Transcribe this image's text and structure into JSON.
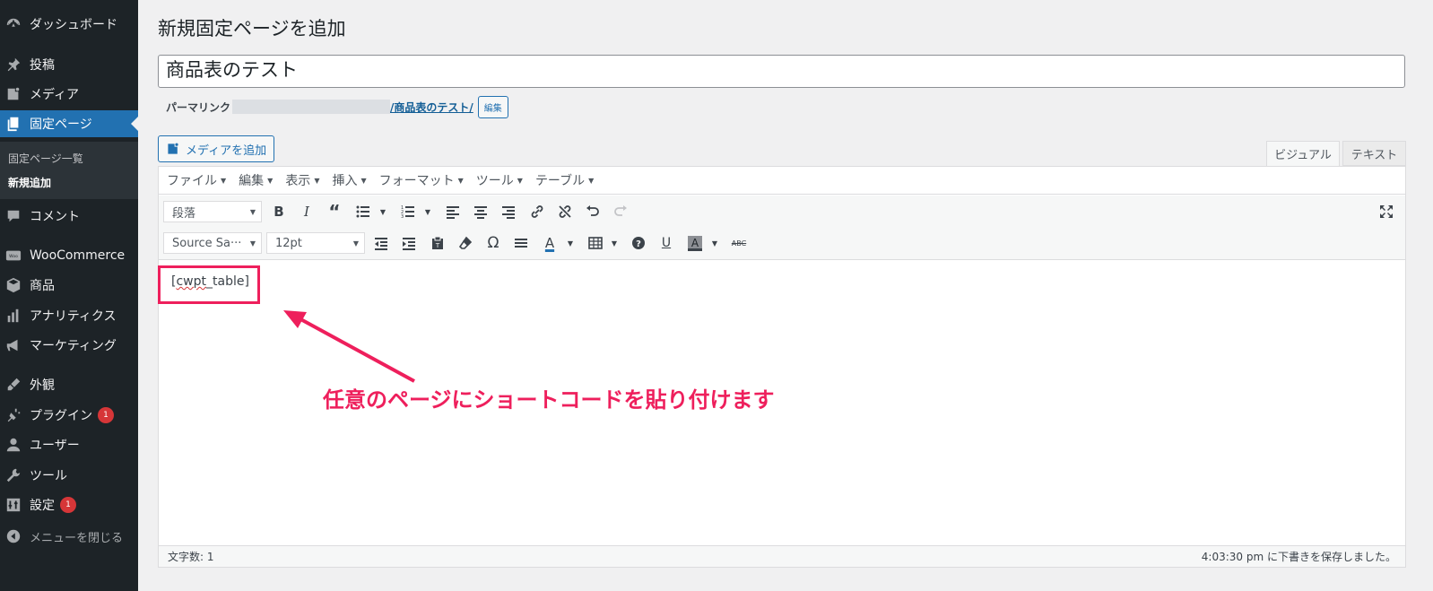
{
  "sidebar": {
    "items": [
      {
        "label": "ダッシュボード",
        "icon": "dashboard-icon"
      },
      {
        "label": "投稿",
        "icon": "pin-icon"
      },
      {
        "label": "メディア",
        "icon": "media-icon"
      },
      {
        "label": "固定ページ",
        "icon": "pages-icon"
      },
      {
        "label": "コメント",
        "icon": "comment-icon"
      },
      {
        "label": "WooCommerce",
        "icon": "woocommerce-icon"
      },
      {
        "label": "商品",
        "icon": "product-box-icon"
      },
      {
        "label": "アナリティクス",
        "icon": "bar-chart-icon"
      },
      {
        "label": "マーケティング",
        "icon": "megaphone-icon"
      },
      {
        "label": "外観",
        "icon": "paintbrush-icon"
      },
      {
        "label": "プラグイン",
        "icon": "plugin-icon",
        "badge": "1"
      },
      {
        "label": "ユーザー",
        "icon": "user-icon"
      },
      {
        "label": "ツール",
        "icon": "wrench-icon"
      },
      {
        "label": "設定",
        "icon": "settings-icon",
        "badge": "1"
      },
      {
        "label": "メニューを閉じる",
        "icon": "collapse-icon"
      }
    ],
    "submenu": [
      "固定ページ一覧",
      "新規追加"
    ]
  },
  "page": {
    "heading": "新規固定ページを追加",
    "title_value": "商品表のテスト",
    "permalink_label": "パーマリンク",
    "permalink_slug": "/商品表のテスト/",
    "permalink_edit": "編集",
    "add_media": "メディアを追加"
  },
  "tabs": {
    "visual": "ビジュアル",
    "text": "テキスト"
  },
  "menubar": [
    "ファイル",
    "編集",
    "表示",
    "挿入",
    "フォーマット",
    "ツール",
    "テーブル"
  ],
  "toolbar": {
    "paragraph_format": "段落",
    "font_family": "Source Sa···",
    "font_size": "12pt"
  },
  "content": {
    "open": "[",
    "word": "cwpt",
    "rest": "_table]"
  },
  "annotation": "任意のページにショートコードを貼り付けます",
  "status": {
    "word_count": "文字数: 1",
    "saved": "4:03:30 pm に下書きを保存しました。"
  },
  "colors": {
    "accent": "#2271b1",
    "annotation": "#ee1f5c",
    "sidebar": "#1d2327"
  }
}
